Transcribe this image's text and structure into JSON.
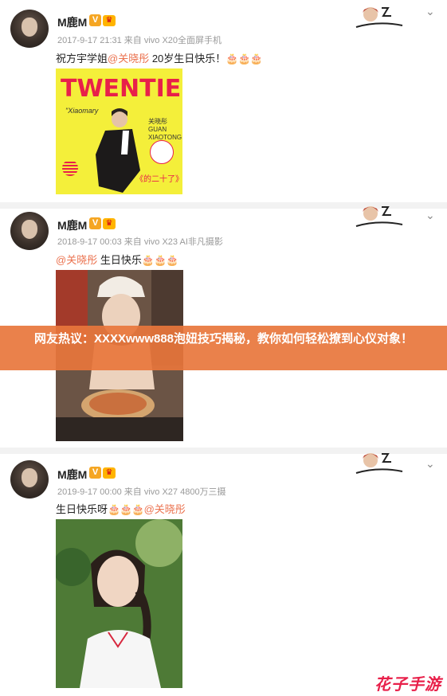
{
  "posts": [
    {
      "username": "M鹿M",
      "badge_v": "V",
      "badge_crown": "♛",
      "meta": "2017-9-17 21:31 来自 vivo X20全面屏手机",
      "text_before": "祝方宇学姐",
      "mention": "@关晓彤",
      "text_after": " 20岁生日快乐！",
      "emoji": "🎂🎂🎂",
      "photo_title": "TWENTIES",
      "photo_script": "\"Xiaomary",
      "photo_caption": "关晓彤 GUAN XIAOTONG",
      "photo_bottom": "《的二十了》"
    },
    {
      "username": "M鹿M",
      "badge_v": "V",
      "badge_crown": "♛",
      "meta": "2018-9-17 00:03 来自 vivo X23 AI非凡摄影",
      "text_before": "",
      "mention": "@关晓彤",
      "text_after": " 生日快乐",
      "emoji": "🎂🎂🎂"
    },
    {
      "username": "M鹿M",
      "badge_v": "V",
      "badge_crown": "♛",
      "meta": "2019-9-17 00:00 来自 vivo X27 4800万三摄",
      "text_before": "生日快乐呀",
      "emoji": "🎂🎂🎂",
      "mention": "@关晓彤",
      "text_after": ""
    }
  ],
  "banner": "网友热议：XXXXwww888泡妞技巧揭秘，教你如何轻松撩到心仪对象！",
  "watermark": "花子手游",
  "chevron": "⌄",
  "colors": {
    "mention": "#eb7350",
    "banner": "#e8763c",
    "accent": "#e8204a"
  }
}
